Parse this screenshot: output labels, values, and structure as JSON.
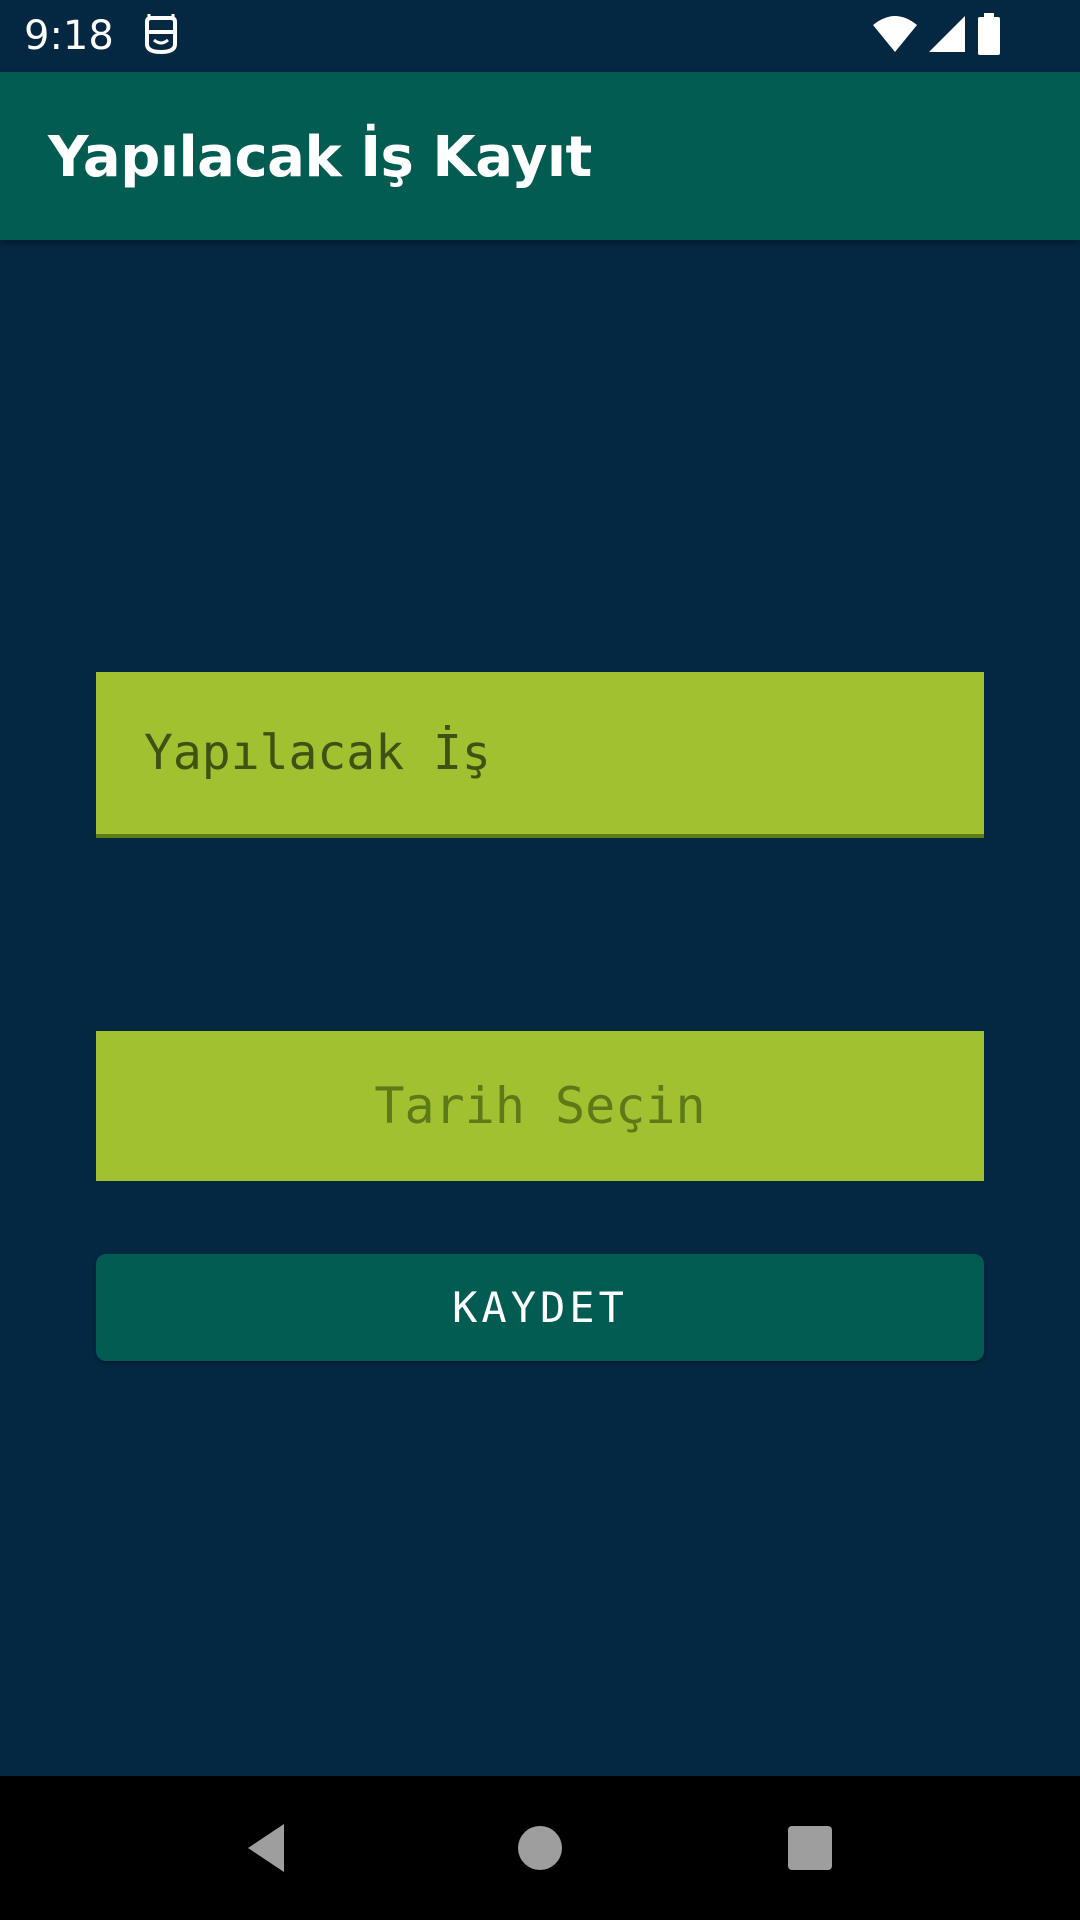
{
  "status_bar": {
    "time": "9:18",
    "app_icon": "robot-notification-icon",
    "wifi_icon": "wifi-icon",
    "signal_icon": "cell-signal-icon",
    "battery_icon": "battery-icon"
  },
  "app_bar": {
    "title": "Yapılacak İş Kayıt"
  },
  "form": {
    "task_placeholder": "Yapılacak İş",
    "task_value": "",
    "date_button_label": "Tarih Seçin",
    "save_button_label": "KAYDET"
  },
  "nav_bar": {
    "back_icon": "back-triangle-icon",
    "home_icon": "home-circle-icon",
    "recents_icon": "recents-square-icon"
  },
  "colors": {
    "background": "#052842",
    "primary": "#025C52",
    "accent_field": "#A2C131",
    "field_text": "#3E5213",
    "date_text": "#5E7A18",
    "nav_bar": "#000000"
  }
}
